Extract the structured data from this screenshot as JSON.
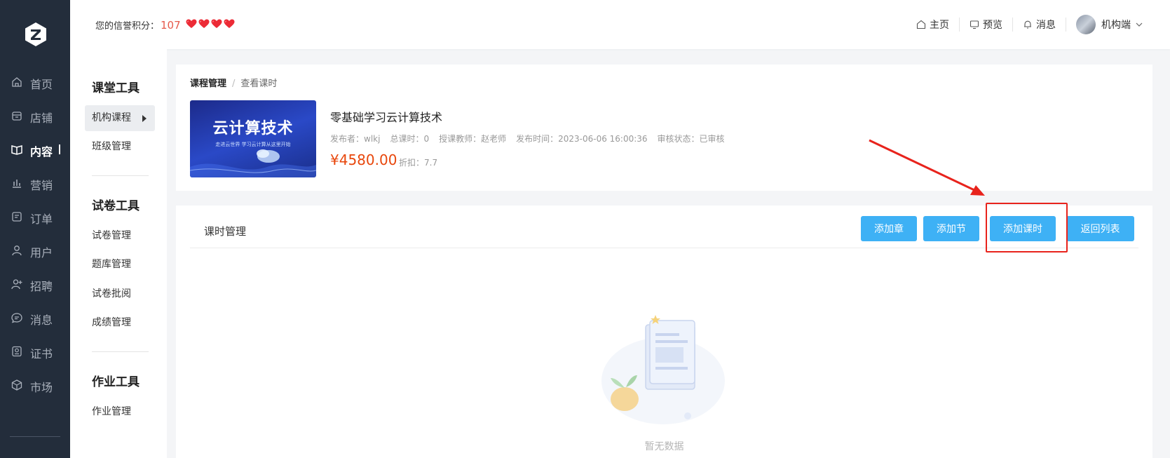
{
  "left_nav": {
    "logo_icon": "z-logo",
    "items": [
      {
        "label": "首页",
        "icon": "home-icon"
      },
      {
        "label": "店铺",
        "icon": "store-icon"
      },
      {
        "label": "内容",
        "icon": "content-book-icon",
        "active": true
      },
      {
        "label": "营销",
        "icon": "chart-bars-icon"
      },
      {
        "label": "订单",
        "icon": "order-doc-icon"
      },
      {
        "label": "用户",
        "icon": "user-icon"
      },
      {
        "label": "招聘",
        "icon": "user-add-icon"
      },
      {
        "label": "消息",
        "icon": "chat-icon"
      },
      {
        "label": "证书",
        "icon": "certificate-icon"
      },
      {
        "label": "市场",
        "icon": "market-cube-icon"
      }
    ]
  },
  "topbar": {
    "credit_label": "您的信誉积分：",
    "credit_value": "107",
    "hearts": 4,
    "links": [
      {
        "label": "主页",
        "icon": "home-icon"
      },
      {
        "label": "预览",
        "icon": "monitor-icon"
      },
      {
        "label": "消息",
        "icon": "bell-icon"
      }
    ],
    "user_name": "机构端"
  },
  "subnav": {
    "sections": [
      {
        "title": "课堂工具",
        "items": [
          "机构课程",
          "班级管理"
        ]
      },
      {
        "title": "试卷工具",
        "items": [
          "试卷管理",
          "题库管理",
          "试卷批阅",
          "成绩管理"
        ]
      },
      {
        "title": "作业工具",
        "items": [
          "作业管理"
        ]
      }
    ],
    "active_item": "机构课程"
  },
  "course": {
    "breadcrumb": [
      "课程管理",
      "查看课时"
    ],
    "thumb_title": "云计算技术",
    "thumb_subtitle": "走进云世界  学习云计算从这里开始",
    "title": "零基础学习云计算技术",
    "publisher": "发布者：wlkj",
    "total_lessons": "总课时：0",
    "teacher": "授课教师：赵老师",
    "publish_time": "发布时间：2023-06-06 16:00:36",
    "review_status": "审核状态：已审核",
    "price": "¥4580.00",
    "discount": "折扣：7.7"
  },
  "lessons": {
    "title": "课时管理",
    "buttons": [
      "添加章",
      "添加节",
      "添加课时",
      "返回列表"
    ],
    "empty_text": "暂无数据"
  },
  "colors": {
    "nav_bg": "#232d3b",
    "button_blue": "#3eb1f5",
    "price_red": "#e8470c",
    "annotation_red": "#e8231c"
  }
}
